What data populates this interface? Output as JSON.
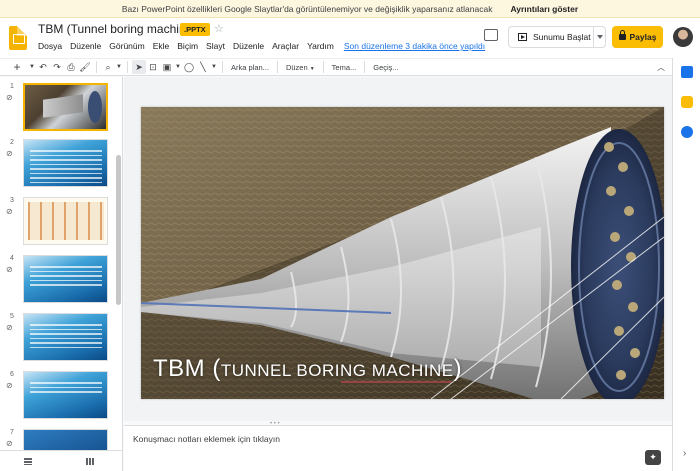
{
  "banner": {
    "message": "Bazı PowerPoint özellikleri Google Slaytlar'da görüntülenemiyor ve değişiklik yaparsanız atlanacak",
    "details_link": "Ayrıntıları göster"
  },
  "header": {
    "doc_title": "TBM (Tunnel boring machine)",
    "format_badge": ".PPTX",
    "present_label": "Sunumu Başlat",
    "share_label": "Paylaş"
  },
  "menu": {
    "items": [
      "Dosya",
      "Düzenle",
      "Görünüm",
      "Ekle",
      "Biçim",
      "Slayt",
      "Düzenle",
      "Araçlar",
      "Yardım"
    ],
    "last_edit": "Son düzenleme 3 dakika önce yapıldı"
  },
  "toolbar": {
    "background_label": "Arka plan...",
    "layout_label": "Düzen",
    "theme_label": "Tema...",
    "transition_label": "Geçiş..."
  },
  "filmstrip": {
    "slide_numbers": [
      "1",
      "2",
      "3",
      "4",
      "5",
      "6",
      "7"
    ],
    "selected_index": 1
  },
  "slide": {
    "title_main": "TBM (",
    "title_smallcaps": "TUNNEL BORING MACHINE",
    "title_end": ")"
  },
  "notes": {
    "placeholder": "Konuşmacı notları eklemek için tıklayın"
  },
  "colors": {
    "accent": "#fbbc04",
    "link": "#1a73e8"
  }
}
